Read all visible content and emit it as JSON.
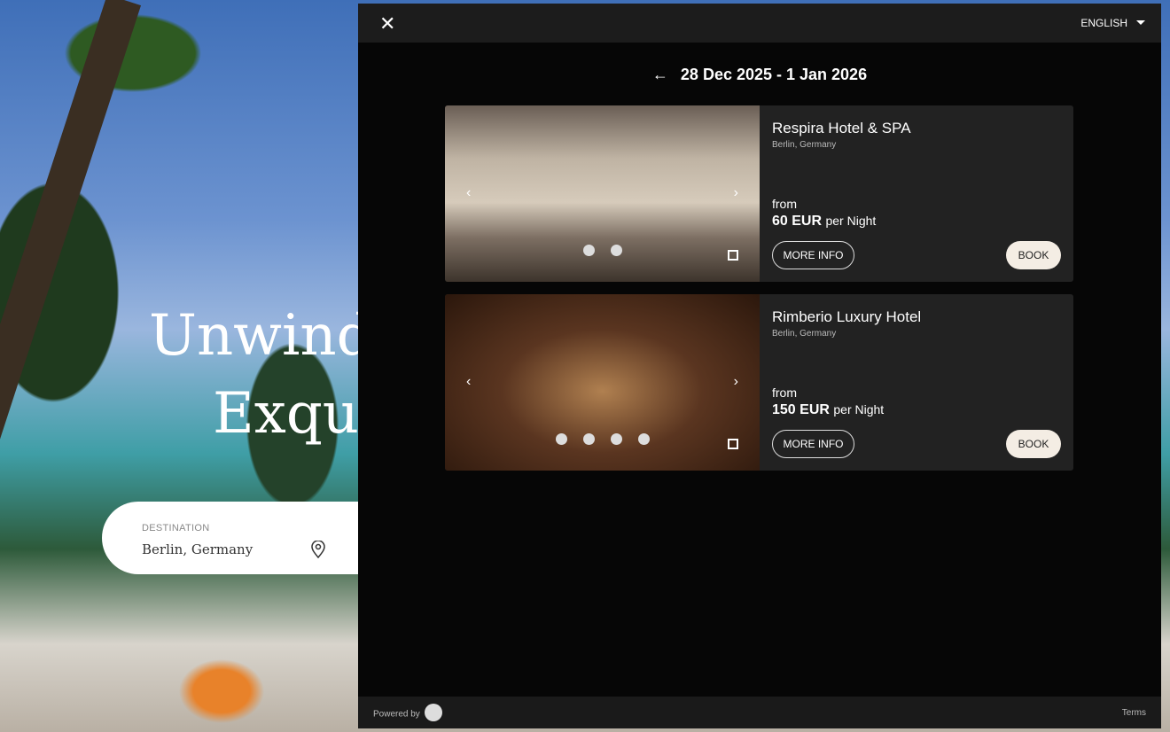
{
  "background": {
    "hero_line1": "Unwind",
    "hero_line2": "Exqui",
    "search": {
      "destination_label": "DESTINATION",
      "destination_value": "Berlin, Germany"
    }
  },
  "modal": {
    "language": "ENGLISH",
    "date_range": "28 Dec 2025 - 1 Jan 2026",
    "hotels": [
      {
        "name": "Respira Hotel & SPA",
        "location": "Berlin, Germany",
        "from_label": "from",
        "price": "60 EUR",
        "per": "per Night",
        "more_info": "MORE INFO",
        "book": "BOOK",
        "image_count": 2
      },
      {
        "name": "Rimberio Luxury Hotel",
        "location": "Berlin, Germany",
        "from_label": "from",
        "price": "150 EUR",
        "per": "per Night",
        "more_info": "MORE INFO",
        "book": "BOOK",
        "image_count": 4
      }
    ],
    "footer": {
      "powered_by": "Powered by",
      "terms": "Terms"
    }
  }
}
